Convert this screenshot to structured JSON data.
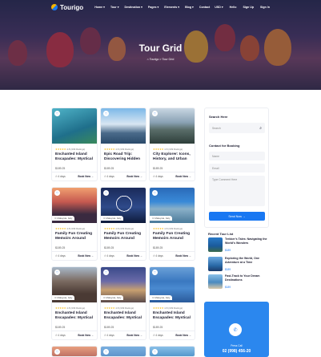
{
  "header": {
    "brand": "Tourigo",
    "menu": [
      "Home ▾",
      "Tour ▾",
      "Destination ▾",
      "Pages ▾",
      "Elements ▾",
      "Blog ▾",
      "Contact"
    ],
    "right": [
      "USD ▾",
      "Hello",
      "Sign Up",
      "Sign In"
    ]
  },
  "hero": {
    "title": "Tour Grid",
    "breadcrumb": "⌂  Tourigo  >  Tour Grid"
  },
  "cards": [
    {
      "loc": "",
      "rating": "4.8 (339 Ratings)",
      "title": "Enchanted Island Escapades: Mystical",
      "price": "$189.25",
      "days": "⏱ 4 days",
      "book": "Book Now →",
      "img": "teal"
    },
    {
      "loc": "",
      "rating": "4.8 (339 Ratings)",
      "title": "Epic Road Trip: Discovering Hidden",
      "price": "$189.25",
      "days": "⏱ 4 days",
      "book": "Book Now →",
      "img": "sky"
    },
    {
      "loc": "",
      "rating": "4.8 (339 Ratings)",
      "title": "City Explorer: Icons, History, and Urban",
      "price": "$189.25",
      "days": "⏱ 4 days",
      "book": "Book Now →",
      "img": "lake"
    },
    {
      "loc": "⊙ Malaysia, Italy",
      "rating": "4.8 (339 Ratings)",
      "title": "Family Fun Creating Memoirs Around",
      "price": "$189.25",
      "days": "⏱ 4 days",
      "book": "Book Now →",
      "img": "sunset"
    },
    {
      "loc": "⊙ Malaysia, Italy",
      "rating": "4.8 (339 Ratings)",
      "title": "Family Fun Creating Memoirs Around",
      "price": "$189.25",
      "days": "⏱ 4 days",
      "book": "Book Now →",
      "img": "wheel"
    },
    {
      "loc": "⊙ Malaysia, Italy",
      "rating": "4.8 (339 Ratings)",
      "title": "Family Fun Creating Memoirs Around",
      "price": "$189.25",
      "days": "⏱ 4 days",
      "book": "Book Now →",
      "img": "coast"
    },
    {
      "loc": "⊙ Malaysia, Italy",
      "rating": "4.8 (339 Ratings)",
      "title": "Enchanted Island Escapades: Mystical",
      "price": "$189.25",
      "days": "⏱ 4 days",
      "book": "Book Now →",
      "img": "street"
    },
    {
      "loc": "⊙ Malaysia, Italy",
      "rating": "4.8 (339 Ratings)",
      "title": "Enchanted Island Escapades: Mystical",
      "price": "$189.25",
      "days": "⏱ 4 days",
      "book": "Book Now →",
      "img": "town"
    },
    {
      "loc": "⊙ Malaysia, Italy",
      "rating": "4.8 (339 Ratings)",
      "title": "Enchanted Island Escapades: Mystical",
      "price": "$189.25",
      "days": "⏱ 4 days",
      "book": "Book Now →",
      "img": "bluecity"
    }
  ],
  "sidebar": {
    "search_heading": "Search Here",
    "search_placeholder": "Search",
    "contact_heading": "Contact for Booking",
    "name_placeholder": "Name",
    "email_placeholder": "Email",
    "comment_placeholder": "Type Comment Here",
    "send_label": "Send Now →",
    "recent_heading": "Recent Tour List",
    "recent": [
      {
        "title": "Trekker's Tales: Navigating the World's Wonders",
        "price": "$189"
      },
      {
        "title": "Exploring the World, One Adventure at a Time",
        "price": "$189"
      },
      {
        "title": "Fast-Track to Your Dream Destinations",
        "price": "$189"
      }
    ],
    "promo_label": "Press Call",
    "promo_phone": "02 (998) 456-20"
  },
  "colors": {
    "accent": "#1877f2",
    "star": "#f5b400",
    "promo": "#2b87ee"
  }
}
